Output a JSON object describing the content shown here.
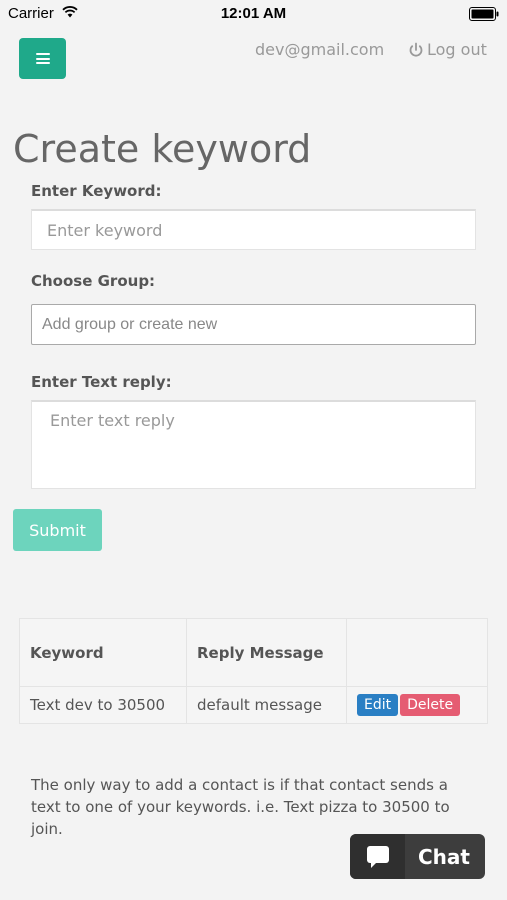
{
  "status_bar": {
    "carrier": "Carrier",
    "time": "12:01 AM"
  },
  "header": {
    "menu_icon": "hamburger-icon",
    "menu_color": "#1fa98a",
    "user_email": "dev@gmail.com",
    "logout_label": "Log out",
    "logout_icon": "power-icon"
  },
  "form": {
    "title": "Create keyword",
    "keyword_label": "Enter Keyword:",
    "keyword_placeholder": "Enter keyword",
    "keyword_value": "",
    "group_label": "Choose Group:",
    "group_placeholder": "Add group or create new",
    "group_value": "",
    "reply_label": "Enter Text reply:",
    "reply_placeholder": "Enter text reply",
    "reply_value": "",
    "submit_label": "Submit"
  },
  "table": {
    "headers": [
      "Keyword",
      "Reply Message",
      ""
    ],
    "rows": [
      {
        "keyword": "Text dev to 30500",
        "reply": "default message",
        "edit_label": "Edit",
        "delete_label": "Delete"
      }
    ]
  },
  "help_text": "The only way to add a contact is if that contact sends a text to one of your keywords. i.e. Text pizza to 30500 to join.",
  "chat_widget": {
    "label": "Chat",
    "icon": "chat-bubble-icon"
  },
  "colors": {
    "accent": "#1fa98a",
    "submit": "#6dd4bd",
    "edit": "#2a7fc4",
    "delete": "#e55c72"
  }
}
